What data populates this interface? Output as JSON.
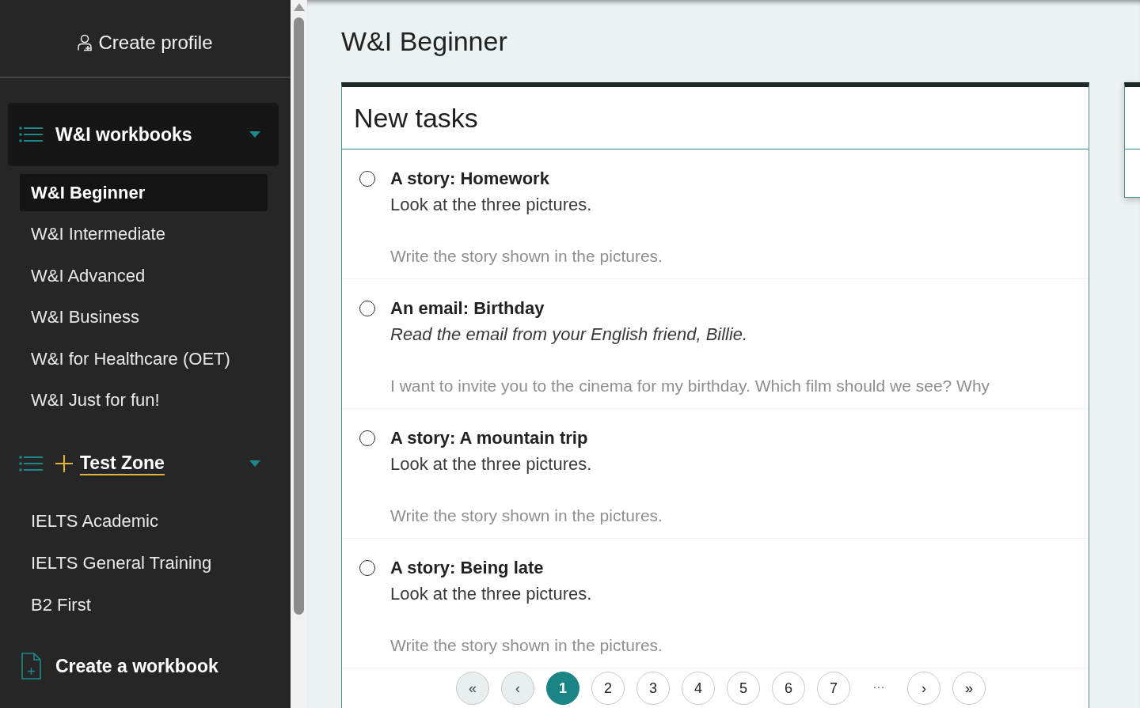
{
  "sidebar": {
    "profile_button": "Create profile",
    "groups": [
      {
        "kind": "menu",
        "label": "W&I workbooks",
        "selected": true,
        "expanded": true,
        "items": [
          {
            "label": "W&I Beginner",
            "selected": true
          },
          {
            "label": "W&I Intermediate",
            "selected": false
          },
          {
            "label": "W&I Advanced",
            "selected": false
          },
          {
            "label": "W&I Business",
            "selected": false
          },
          {
            "label": "W&I for Healthcare (OET)",
            "selected": false
          },
          {
            "label": "W&I Just for fun!",
            "selected": false
          }
        ]
      },
      {
        "kind": "promo",
        "label": "Test Zone",
        "selected": false,
        "expanded": true,
        "items": [
          {
            "label": "IELTS Academic",
            "selected": false
          },
          {
            "label": "IELTS General Training",
            "selected": false
          },
          {
            "label": "B2 First",
            "selected": false
          }
        ]
      }
    ],
    "create_button": "Create a workbook"
  },
  "page": {
    "title": "W&I Beginner"
  },
  "task_card": {
    "title": "New tasks",
    "tasks": [
      {
        "kind": "story",
        "title": "A story: Homework",
        "description": "Look at the three pictures.",
        "preview": "Write the story shown in the pictures.",
        "selected": false
      },
      {
        "kind": "email",
        "title": "An email: Birthday",
        "description": "Read the email from your English friend, Billie.",
        "preview": "I want to invite you to the cinema for my birthday. Which film should we see? Why",
        "selected": false
      },
      {
        "kind": "story",
        "title": "A story: A mountain trip",
        "description": "Look at the three pictures.",
        "preview": "Write the story shown in the pictures.",
        "selected": false
      },
      {
        "kind": "story",
        "title": "A story: Being late",
        "description": "Look at the three pictures.",
        "preview": "Write the story shown in the pictures.",
        "selected": false
      }
    ],
    "pagination": [
      {
        "kind": "nav",
        "label": "«",
        "disabled": true
      },
      {
        "kind": "nav",
        "label": "‹",
        "disabled": true
      },
      {
        "kind": "page",
        "label": "1",
        "selected": true
      },
      {
        "kind": "page",
        "label": "2",
        "selected": false
      },
      {
        "kind": "page",
        "label": "3",
        "selected": false
      },
      {
        "kind": "page",
        "label": "4",
        "selected": false
      },
      {
        "kind": "page",
        "label": "5",
        "selected": false
      },
      {
        "kind": "page",
        "label": "6",
        "selected": false
      },
      {
        "kind": "page",
        "label": "7",
        "selected": false
      },
      {
        "kind": "gap",
        "label": "…"
      },
      {
        "kind": "nav",
        "label": "›",
        "disabled": false
      },
      {
        "kind": "nav",
        "label": "»",
        "disabled": false
      }
    ]
  }
}
